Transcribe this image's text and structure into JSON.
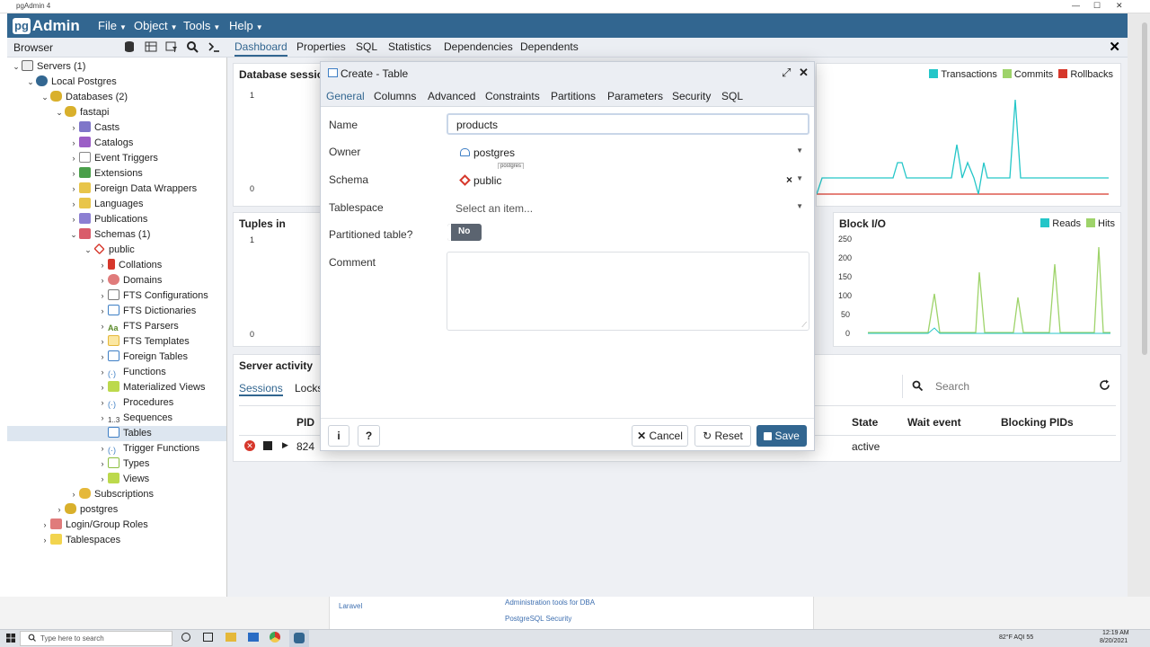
{
  "os_window": {
    "title": "pgAdmin 4",
    "min": "—",
    "max": "☐",
    "close": "✕"
  },
  "app": {
    "logo_pg": "pg",
    "logo_admin": "Admin"
  },
  "menu": {
    "file": "File",
    "object": "Object",
    "tools": "Tools",
    "help": "Help"
  },
  "browser": {
    "title": "Browser",
    "tree": [
      {
        "label": "Servers (1)"
      },
      {
        "label": "Local Postgres"
      },
      {
        "label": "Databases (2)"
      },
      {
        "label": "fastapi"
      },
      {
        "label": "Casts"
      },
      {
        "label": "Catalogs"
      },
      {
        "label": "Event Triggers"
      },
      {
        "label": "Extensions"
      },
      {
        "label": "Foreign Data Wrappers"
      },
      {
        "label": "Languages"
      },
      {
        "label": "Publications"
      },
      {
        "label": "Schemas (1)"
      },
      {
        "label": "public"
      },
      {
        "label": "Collations"
      },
      {
        "label": "Domains"
      },
      {
        "label": "FTS Configurations"
      },
      {
        "label": "FTS Dictionaries"
      },
      {
        "label": "FTS Parsers"
      },
      {
        "label": "FTS Templates"
      },
      {
        "label": "Foreign Tables"
      },
      {
        "label": "Functions"
      },
      {
        "label": "Materialized Views"
      },
      {
        "label": "Procedures"
      },
      {
        "label": "Sequences"
      },
      {
        "label": "Tables"
      },
      {
        "label": "Trigger Functions"
      },
      {
        "label": "Types"
      },
      {
        "label": "Views"
      },
      {
        "label": "Subscriptions"
      },
      {
        "label": "postgres"
      },
      {
        "label": "Login/Group Roles"
      },
      {
        "label": "Tablespaces"
      }
    ]
  },
  "main_tabs": [
    "Dashboard",
    "Properties",
    "SQL",
    "Statistics",
    "Dependencies",
    "Dependents"
  ],
  "dashboard": {
    "db_sessions": {
      "title": "Database sessions",
      "y_top": "1",
      "y_bottom": "0"
    },
    "tps": {
      "legend": [
        "Transactions",
        "Commits",
        "Rollbacks"
      ]
    },
    "tuples_in": {
      "title": "Tuples in",
      "y_top": "1",
      "y_bottom": "0"
    },
    "block_io": {
      "title": "Block I/O",
      "legend": [
        "Reads",
        "Hits"
      ],
      "y_ticks": [
        "250",
        "200",
        "150",
        "100",
        "50",
        "0"
      ]
    },
    "server_activity": {
      "title": "Server activity",
      "tabs": [
        "Sessions",
        "Locks"
      ],
      "search_placeholder": "Search",
      "columns": [
        "PID",
        "State",
        "Wait event",
        "Blocking PIDs"
      ],
      "row": {
        "pid": "824",
        "state": "active"
      }
    }
  },
  "dialog": {
    "title": "Create - Table",
    "tabs": [
      "General",
      "Columns",
      "Advanced",
      "Constraints",
      "Partitions",
      "Parameters",
      "Security",
      "SQL"
    ],
    "fields": {
      "name_label": "Name",
      "name_value": "products",
      "owner_label": "Owner",
      "owner_value": "postgres",
      "owner_tooltip": "postgres",
      "schema_label": "Schema",
      "schema_value": "public",
      "schema_clear": "×",
      "tablespace_label": "Tablespace",
      "tablespace_placeholder": "Select an item...",
      "partitioned_label": "Partitioned table?",
      "partitioned_value": "No",
      "comment_label": "Comment"
    },
    "buttons": {
      "info": "i",
      "help": "?",
      "cancel": "Cancel",
      "reset": "Reset",
      "save": "Save"
    }
  },
  "behind_links": [
    "Laravel",
    "Administration tools for DBA",
    "PostgreSQL Security"
  ],
  "taskbar": {
    "search_placeholder": "Type here to search",
    "weather": "82°F  AQI 55",
    "time": "12:19 AM",
    "date": "8/20/2021"
  },
  "colors": {
    "header": "#326690",
    "transactions": "#24c6c8",
    "commits": "#9ed36a",
    "rollbacks": "#d6372b",
    "save_button": "#326690"
  }
}
